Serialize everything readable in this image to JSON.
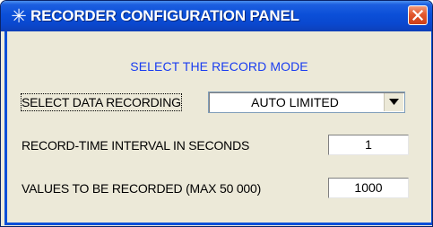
{
  "window": {
    "title": "RECORDER CONFIGURATION PANEL",
    "title_icon": "asterisk-icon",
    "close_icon": "close-icon"
  },
  "panel": {
    "heading": "SELECT THE RECORD MODE",
    "data_recording": {
      "label": "SELECT DATA RECORDING",
      "selected": "AUTO LIMITED"
    },
    "interval": {
      "label": "RECORD-TIME INTERVAL IN SECONDS",
      "value": "1"
    },
    "values_count": {
      "label": "VALUES TO BE RECORDED (MAX 50 000)",
      "value": "1000"
    }
  },
  "colors": {
    "title_bar": "#0b4fd8",
    "heading_text": "#1a3df0",
    "close_button": "#e2582e",
    "panel_background": "#ece9d8"
  }
}
